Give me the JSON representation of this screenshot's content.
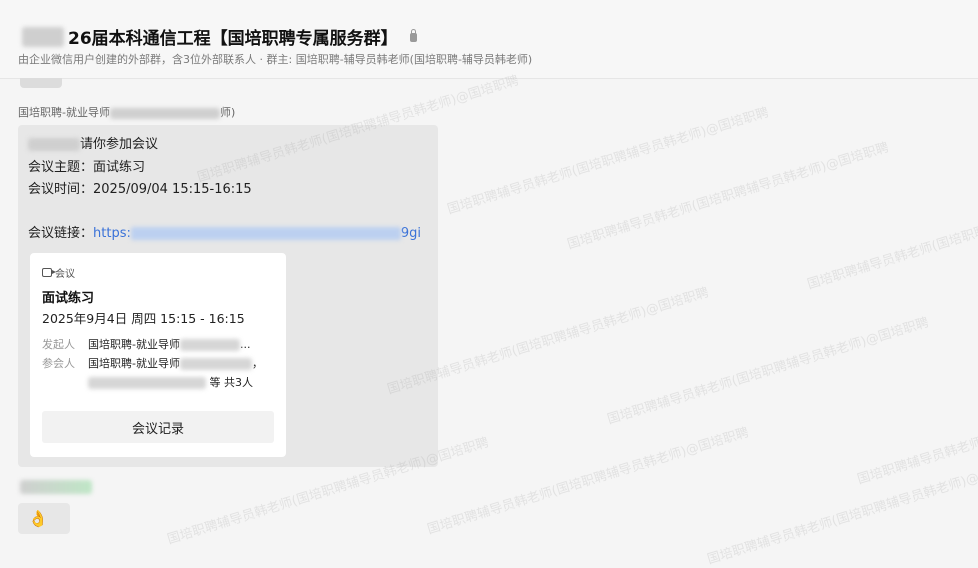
{
  "header": {
    "title": "26届本科通信工程【国培职聘专属服务群】",
    "subtitle": "由企业微信用户创建的外部群，含3位外部联系人 · 群主: 国培职聘-辅导员韩老师(国培职聘-辅导员韩老师)"
  },
  "message": {
    "sender_prefix": "国培职聘-就业导师",
    "sender_suffix": "师)",
    "invite_text": "请你参加会议",
    "topic_line": "会议主题：面试练习",
    "time_line": "会议时间：2025/09/04 15:15-16:15",
    "link_label": "会议链接：",
    "link_start": "https:",
    "link_end": "9gi"
  },
  "card": {
    "type_label": "会议",
    "title": "面试练习",
    "time": "2025年9月4日 周四 15:15 - 16:15",
    "initiator_label": "发起人",
    "initiator_value": "国培职聘-就业导师",
    "initiator_ellipsis": "...",
    "attendees_label": "参会人",
    "attendees_value": "国培职聘-就业导师",
    "attendees_comma": "，",
    "attendees_total": "等 共3人",
    "record_button": "会议记录"
  },
  "watermark_text": "国培职聘辅导员韩老师(国培职聘辅导员韩老师)@国培职聘",
  "emoji": "👌"
}
